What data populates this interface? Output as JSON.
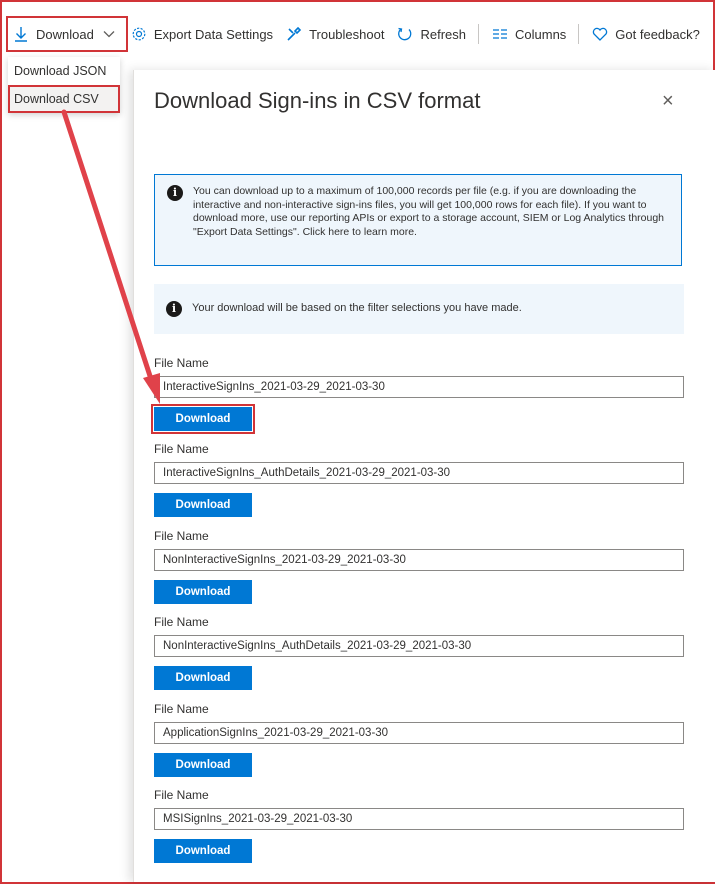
{
  "toolbar": {
    "download_label": "Download",
    "export_label": "Export Data Settings",
    "troubleshoot_label": "Troubleshoot",
    "refresh_label": "Refresh",
    "columns_label": "Columns",
    "feedback_label": "Got feedback?"
  },
  "menu": {
    "items": [
      "Download JSON",
      "Download CSV"
    ],
    "selected": "Download CSV"
  },
  "panel": {
    "title": "Download Sign-ins in CSV format",
    "close_icon": "×",
    "info_text": "You can download up to a maximum of 100,000 records per file (e.g. if you are downloading the interactive and non-interactive sign-ins files, you will get 100,000 rows for each file).  If you want to download more, use our reporting APIs or export to a storage account, SIEM or Log Analytics through \"Export Data Settings\". Click here to learn more.",
    "filter_text": "Your download will be based on the filter selections you have made.",
    "files": [
      {
        "label": "File Name",
        "value": "InteractiveSignIns_2021-03-29_2021-03-30",
        "button": "Download"
      },
      {
        "label": "File Name",
        "value": "InteractiveSignIns_AuthDetails_2021-03-29_2021-03-30",
        "button": "Download"
      },
      {
        "label": "File Name",
        "value": "NonInteractiveSignIns_2021-03-29_2021-03-30",
        "button": "Download"
      },
      {
        "label": "File Name",
        "value": "NonInteractiveSignIns_AuthDetails_2021-03-29_2021-03-30",
        "button": "Download"
      },
      {
        "label": "File Name",
        "value": "ApplicationSignIns_2021-03-29_2021-03-30",
        "button": "Download"
      },
      {
        "label": "File Name",
        "value": "MSISignIns_2021-03-29_2021-03-30",
        "button": "Download"
      }
    ]
  },
  "colors": {
    "accent": "#0078d4",
    "highlight": "#d13438"
  }
}
